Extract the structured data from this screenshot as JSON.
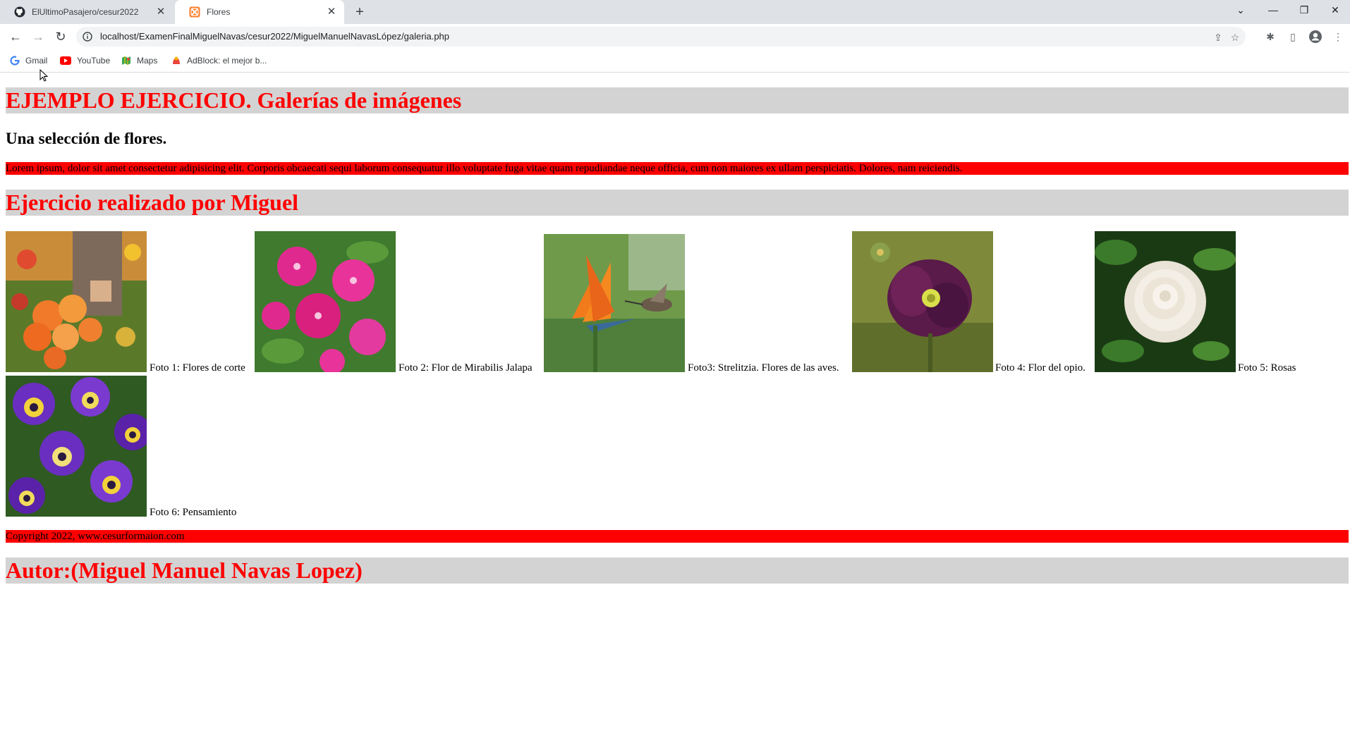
{
  "browser": {
    "tabs": [
      {
        "title": "ElUltimoPasajero/cesur2022",
        "icon": "github-icon"
      },
      {
        "title": "Flores",
        "icon": "xampp-icon"
      }
    ],
    "url": "localhost/ExamenFinalMiguelNavas/cesur2022/MiguelManuelNavasLópez/galeria.php",
    "bookmarks": [
      {
        "label": "Gmail",
        "icon": "google-icon"
      },
      {
        "label": "YouTube",
        "icon": "youtube-icon"
      },
      {
        "label": "Maps",
        "icon": "maps-icon"
      },
      {
        "label": "AdBlock: el mejor b...",
        "icon": "adblock-icon"
      }
    ]
  },
  "page": {
    "title": "EJEMPLO EJERCICIO. Galerías de imágenes",
    "subtitle": "Una selección de flores.",
    "lorem": "Lorem ipsum, dolor sit amet consectetur adipisicing elit. Corporis obcaecati sequi laborum consequatur illo voluptate fuga vitae quam repudiandae neque officia, cum non maiores ex ullam perspiciatis. Dolores, nam reiciendis.",
    "author_heading": "Ejercicio realizado por Miguel",
    "gallery": [
      {
        "caption": "Foto 1: Flores de corte",
        "subject": "cut-flowers-dahlias"
      },
      {
        "caption": "Foto 2: Flor de Mirabilis Jalapa",
        "subject": "mirabilis-jalapa"
      },
      {
        "caption": "Foto3: Strelitzia. Flores de las aves.",
        "subject": "strelitzia-hummingbird"
      },
      {
        "caption": "Foto 4: Flor del opio.",
        "subject": "opium-poppy"
      },
      {
        "caption": "Foto 5: Rosas",
        "subject": "white-rose"
      },
      {
        "caption": "Foto 6: Pensamiento",
        "subject": "pansies"
      }
    ],
    "copyright": "Copyright 2022, www.cesurformaion.com",
    "footer_heading": "Autor:(Miguel Manuel Navas Lopez)"
  },
  "colors": {
    "heading_red": "#ff0000",
    "heading_bg": "#d3d3d3",
    "bar_red": "#ff0000"
  }
}
